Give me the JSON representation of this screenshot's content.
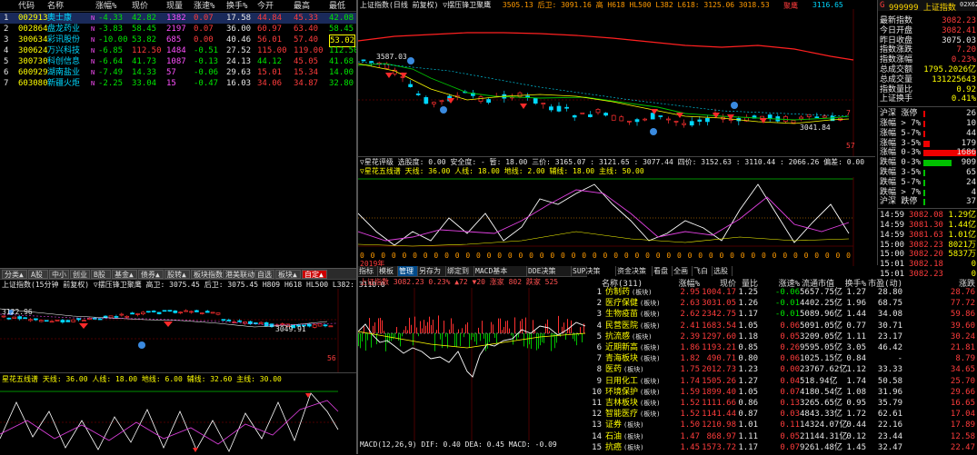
{
  "watchlist": {
    "headers": [
      "代码",
      "名称",
      "涨幅%",
      "现价",
      "现量",
      "涨速%",
      "换手%",
      "今开",
      "最高",
      "最低"
    ],
    "rows": [
      {
        "idx": "1",
        "code": "002913",
        "name": "奥士康",
        "flag": "N",
        "chg": "-4.33",
        "price": "42.82",
        "vol": "1382",
        "speed": "0.07",
        "turn": "17.58",
        "open": "44.84",
        "high": "45.33",
        "low": "42.08"
      },
      {
        "idx": "2",
        "code": "002864",
        "name": "盘龙药业",
        "flag": "N",
        "chg": "-3.83",
        "price": "58.45",
        "vol": "2197",
        "speed": "0.07",
        "turn": "36.00",
        "open": "60.97",
        "high": "63.40",
        "low": "58.45"
      },
      {
        "idx": "3",
        "code": "300634",
        "name": "彩讯股份",
        "flag": "N",
        "chg": "-10.00",
        "price": "53.82",
        "vol": "685",
        "speed": "0.00",
        "turn": "40.46",
        "open": "56.01",
        "high": "57.40",
        "low": "53.02"
      },
      {
        "idx": "4",
        "code": "300624",
        "name": "万兴科技",
        "flag": "N",
        "chg": "-6.85",
        "price": "112.50",
        "vol": "1484",
        "speed": "-0.51",
        "turn": "27.52",
        "open": "115.00",
        "high": "119.00",
        "low": "112.50"
      },
      {
        "idx": "5",
        "code": "300730",
        "name": "科创信息",
        "flag": "N",
        "chg": "-6.64",
        "price": "41.73",
        "vol": "1087",
        "speed": "-0.13",
        "turn": "24.13",
        "open": "44.12",
        "high": "45.05",
        "low": "41.68"
      },
      {
        "idx": "6",
        "code": "600929",
        "name": "湖南盐业",
        "flag": "N",
        "chg": "-7.49",
        "price": "14.33",
        "vol": "57",
        "speed": "-0.06",
        "turn": "29.63",
        "open": "15.01",
        "high": "15.34",
        "low": "14.00"
      },
      {
        "idx": "7",
        "code": "603080",
        "name": "新疆火炬",
        "flag": "N",
        "chg": "-2.25",
        "price": "33.04",
        "vol": "15",
        "speed": "-0.47",
        "turn": "16.03",
        "open": "34.06",
        "high": "34.87",
        "low": "32.80"
      }
    ]
  },
  "tabs": [
    "分类▲",
    "A股",
    "中小",
    "创业",
    "B股",
    "基金▲",
    "债券▲",
    "股转▲",
    "板块指数",
    "港美联动",
    "自选",
    "板块▲",
    "自定▲"
  ],
  "main_chart": {
    "title": "上证指数(日线 前复权) ▽摆压锋卫聚鹰",
    "values": "3505.13  后卫: 3091.16  高  H618  HL500  L382  L618: 3125.06  3018.53",
    "label_right": "聚鹰",
    "label_right2": "3116.65",
    "hi_label": "3587.03",
    "lo_label": "3041.84",
    "num7": "7",
    "num57": "57"
  },
  "ind1": {
    "title": "▽星花评级  选股度: 0.00  安全度: -  暂: 18.00  三价: 3165.07 : 3121.65  : 3077.44  四价: 3152.63  : 3110.44  : 2066.26  偏差: 0.00",
    "title2": "▽星花五线谱  天线: 36.00  人线: 18.00  地线: 2.00  辅线: 18.00  主线: 50.00",
    "axis_dates": "2019年",
    "zeros": "0 0 0 0 0 0 0 0 0 0 0 0 0 0 0 0 0 0 0 0 0 0 0 0 0 0 0 0 0 0 0 0 0 0 0 0 0 0 0 0 0 0 0 0 0 0 0 0 0 0 0 0 0"
  },
  "left_chart": {
    "title": "上证指数(15分钟 前复权) ▽摆压锋卫聚鹰  高卫: 3075.45  后卫: 3075.45  H809  H618  HL500  L382: 3110.0",
    "price_label": "3122.96",
    "lo_label": "3049.91",
    "num": "56",
    "ind_title": "星花五线谱  天线: 36.00  人线: 18.00  地线: 6.00  辅线: 32.60  主线: 30.00"
  },
  "buttons": [
    "指标",
    "模板",
    "管理",
    "另存为",
    "绑定到",
    "MACD基本",
    "DDE决策",
    "SUP决策",
    "资金决策",
    "看盘",
    "全画",
    "飞白",
    "选股"
  ],
  "intraday": {
    "title": "上证指数  3082.23  0.23%  ▲72  ▼20  涨家 802  跌家 525",
    "macd": "MACD(12,26,9)  DIF: 0.40  DEA: 0.45  MACD: -0.09"
  },
  "sectors": {
    "headers": [
      "名称(311)",
      "涨幅%",
      "现价",
      "量比",
      "涨速%",
      "流通市值",
      "换手%",
      "市盈(动)",
      "涨跌"
    ],
    "rows": [
      {
        "i": "1",
        "name": "仿制药",
        "tag": "(板块)",
        "chg": "2.95",
        "price": "1004.17",
        "vr": "1.25",
        "spd": "-0.06",
        "cap": "5657.75亿",
        "turn": "1.27",
        "pe": "28.80",
        "diff": "28.76"
      },
      {
        "i": "2",
        "name": "医疗保健",
        "tag": "(板块)",
        "chg": "2.63",
        "price": "3031.05",
        "vr": "1.26",
        "spd": "-0.01",
        "cap": "4402.25亿",
        "turn": "1.96",
        "pe": "68.75",
        "diff": "77.72"
      },
      {
        "i": "3",
        "name": "生物疫苗",
        "tag": "(板块)",
        "chg": "2.62",
        "price": "2342.75",
        "vr": "1.17",
        "spd": "-0.01",
        "cap": "5089.96亿",
        "turn": "1.44",
        "pe": "34.08",
        "diff": "59.86"
      },
      {
        "i": "4",
        "name": "民营医院",
        "tag": "(板块)",
        "chg": "2.41",
        "price": "1683.54",
        "vr": "1.05",
        "spd": "0.06",
        "cap": "5091.05亿",
        "turn": "0.77",
        "pe": "30.71",
        "diff": "39.60"
      },
      {
        "i": "5",
        "name": "抗流感",
        "tag": "(板块)",
        "chg": "2.39",
        "price": "1297.60",
        "vr": "1.18",
        "spd": "0.05",
        "cap": "3209.05亿",
        "turn": "1.11",
        "pe": "23.17",
        "diff": "30.24"
      },
      {
        "i": "6",
        "name": "近期新高",
        "tag": "(板块)",
        "chg": "1.86",
        "price": "1193.21",
        "vr": "0.85",
        "spd": "0.26",
        "cap": "9595.05亿",
        "turn": "3.05",
        "pe": "46.42",
        "diff": "21.81"
      },
      {
        "i": "7",
        "name": "青海板块",
        "tag": "(板块)",
        "chg": "1.82",
        "price": "490.71",
        "vr": "0.80",
        "spd": "0.06",
        "cap": "1025.15亿",
        "turn": "0.84",
        "pe": "-",
        "diff": "8.79"
      },
      {
        "i": "8",
        "name": "医药",
        "tag": "(板块)",
        "chg": "1.75",
        "price": "2012.73",
        "vr": "1.23",
        "spd": "0.00",
        "cap": "23767.62亿",
        "turn": "1.12",
        "pe": "33.33",
        "diff": "34.65"
      },
      {
        "i": "9",
        "name": "日用化工",
        "tag": "(板块)",
        "chg": "1.74",
        "price": "1505.26",
        "vr": "1.27",
        "spd": "0.04",
        "cap": "518.94亿",
        "turn": "1.74",
        "pe": "50.58",
        "diff": "25.70"
      },
      {
        "i": "10",
        "name": "环境保护",
        "tag": "(板块)",
        "chg": "1.59",
        "price": "1899.40",
        "vr": "1.05",
        "spd": "0.07",
        "cap": "4180.54亿",
        "turn": "1.08",
        "pe": "31.96",
        "diff": "29.66"
      },
      {
        "i": "11",
        "name": "吉林板块",
        "tag": "(板块)",
        "chg": "1.52",
        "price": "1111.66",
        "vr": "0.86",
        "spd": "0.13",
        "cap": "3265.65亿",
        "turn": "0.95",
        "pe": "35.79",
        "diff": "16.65"
      },
      {
        "i": "12",
        "name": "智能医疗",
        "tag": "(板块)",
        "chg": "1.52",
        "price": "1141.44",
        "vr": "0.87",
        "spd": "0.03",
        "cap": "4843.33亿",
        "turn": "1.72",
        "pe": "62.61",
        "diff": "17.04"
      },
      {
        "i": "13",
        "name": "证券",
        "tag": "(板块)",
        "chg": "1.50",
        "price": "1210.98",
        "vr": "1.01",
        "spd": "0.11",
        "cap": "14324.07亿",
        "turn": "0.44",
        "pe": "22.16",
        "diff": "17.89"
      },
      {
        "i": "14",
        "name": "石油",
        "tag": "(板块)",
        "chg": "1.47",
        "price": "868.97",
        "vr": "1.11",
        "spd": "0.05",
        "cap": "21144.31亿",
        "turn": "0.12",
        "pe": "23.44",
        "diff": "12.58"
      },
      {
        "i": "15",
        "name": "抗癌",
        "tag": "(板块)",
        "chg": "1.45",
        "price": "1573.72",
        "vr": "1.17",
        "spd": "0.07",
        "cap": "9261.48亿",
        "turn": "1.45",
        "pe": "32.47",
        "diff": "22.47"
      }
    ]
  },
  "index_info": {
    "header": "999999 上证指数",
    "header_g": "G",
    "header_right": "02X62",
    "rows": [
      {
        "l": "最新指数",
        "v": "3082.23",
        "c": "r"
      },
      {
        "l": "今日开盘",
        "v": "3082.41",
        "c": "r"
      },
      {
        "l": "昨日收盘",
        "v": "3075.03",
        "c": "w"
      },
      {
        "l": "指数涨跌",
        "v": "7.20",
        "c": "r"
      },
      {
        "l": "指数涨幅",
        "v": "0.23%",
        "c": "r"
      },
      {
        "l": "总成交额",
        "v": "1795.2026亿",
        "c": "y"
      },
      {
        "l": "总成交量",
        "v": "131225643",
        "c": "y"
      },
      {
        "l": "指数量比",
        "v": "0.92",
        "c": "y"
      },
      {
        "l": "上证换手",
        "v": "0.41%",
        "c": "y"
      }
    ],
    "dist": [
      {
        "l": "沪深 涨停",
        "v": "26",
        "c": "r",
        "bar": 0.02
      },
      {
        "l": "涨幅 > 7%",
        "v": "10",
        "c": "r",
        "bar": 0.01
      },
      {
        "l": "涨幅 5-7%",
        "v": "44",
        "c": "r",
        "bar": 0.03
      },
      {
        "l": "涨幅 3-5%",
        "v": "179",
        "c": "r",
        "bar": 0.12
      },
      {
        "l": "涨幅 0-3%",
        "v": "1686",
        "c": "r",
        "bar": 1.0
      },
      {
        "l": "跌幅 0-3%",
        "v": "909",
        "c": "g",
        "bar": 0.54
      },
      {
        "l": "跌幅 3-5%",
        "v": "65",
        "c": "g",
        "bar": 0.04
      },
      {
        "l": "跌幅 5-7%",
        "v": "24",
        "c": "g",
        "bar": 0.02
      },
      {
        "l": "跌幅 > 7%",
        "v": "4",
        "c": "g",
        "bar": 0.01
      },
      {
        "l": "沪深 跌停",
        "v": "37",
        "c": "g",
        "bar": 0.02
      }
    ],
    "ticks": [
      {
        "t": "14:59",
        "p": "3082.08",
        "v": "1.29亿"
      },
      {
        "t": "14:59",
        "p": "3081.30",
        "v": "1.44亿"
      },
      {
        "t": "14:59",
        "p": "3081.63",
        "v": "1.01亿"
      },
      {
        "t": "15:00",
        "p": "3082.23",
        "v": "8021万"
      },
      {
        "t": "15:00",
        "p": "3082.20",
        "v": "5837万"
      },
      {
        "t": "15:01",
        "p": "3082.18",
        "v": "0"
      },
      {
        "t": "15:01",
        "p": "3082.23",
        "v": "0"
      }
    ]
  },
  "colors": {
    "up": "#ff3c3c",
    "down": "#00e600",
    "accent": "#ffff00",
    "bg": "#000000"
  }
}
